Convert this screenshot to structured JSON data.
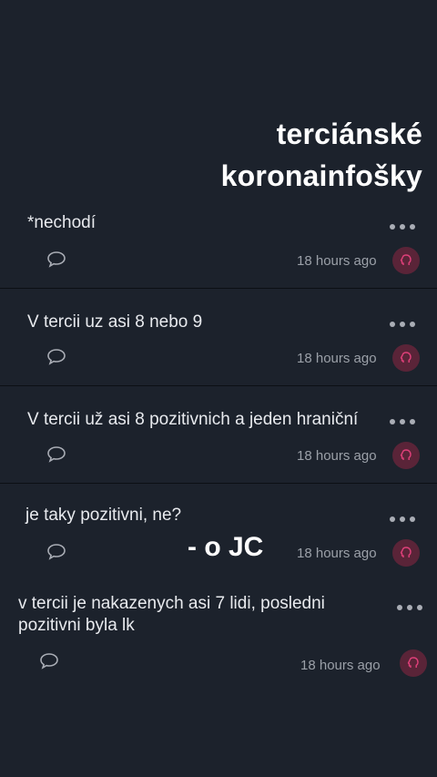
{
  "header": {
    "title_line1": "terciánské",
    "title_line2": "koronainfošky"
  },
  "posts": [
    {
      "text": "*nechodí",
      "time": "18 hours ago"
    },
    {
      "text": "V tercii uz asi 8 nebo 9",
      "time": "18 hours ago"
    },
    {
      "text": "V tercii už asi 8 pozitivnich a jeden hraniční",
      "time": "18 hours ago"
    },
    {
      "text": "je taky pozitivni, ne?",
      "time": "18 hours ago"
    },
    {
      "text": "v tercii je nakazenych asi 7 lidi, posledni pozitivni byla lk",
      "time": "18 hours ago"
    }
  ],
  "overlay_text": "- o JC",
  "colors": {
    "background": "#1c222c",
    "avatar": "#5a2438",
    "avatar_icon": "#e0407a"
  },
  "icons": {
    "more": "more-dots-icon",
    "comment": "comment-icon",
    "avatar": "brain-icon"
  }
}
